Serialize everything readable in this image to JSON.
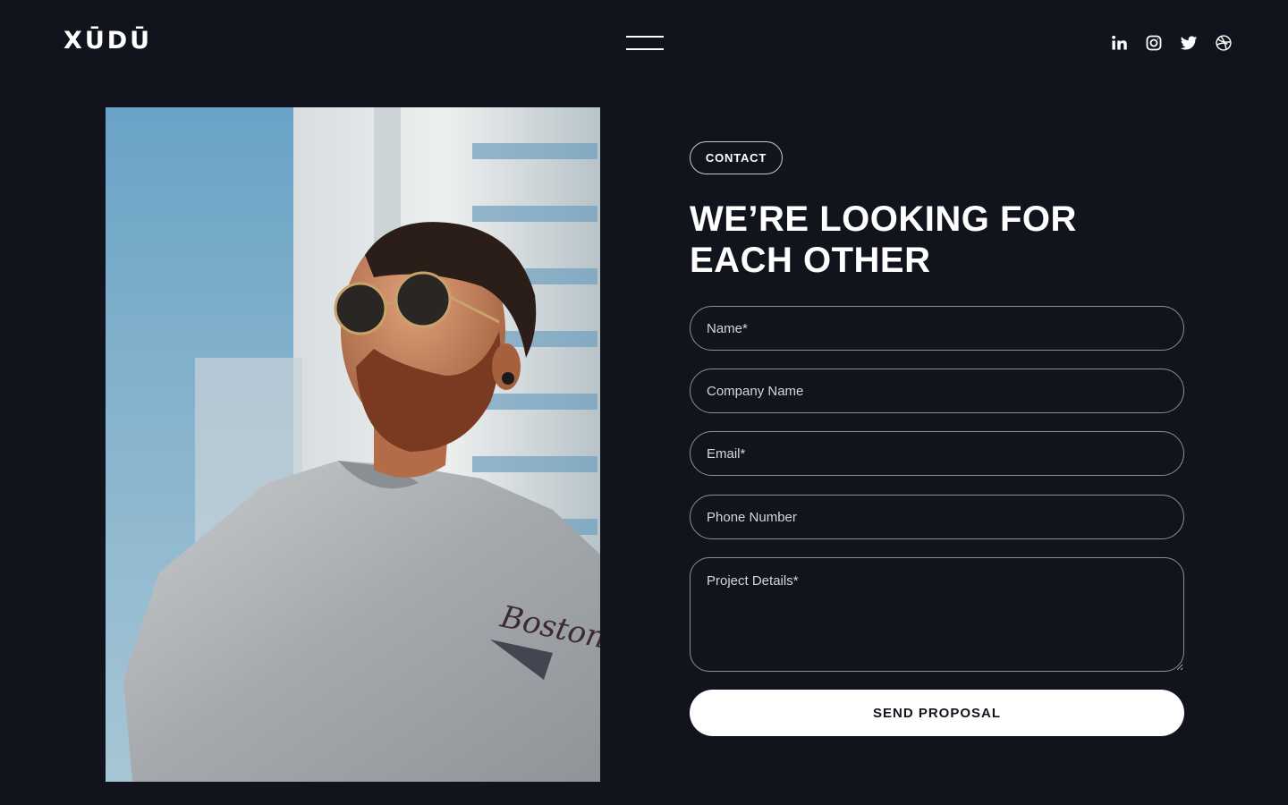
{
  "header": {
    "logo": "XŪDŪ",
    "menu_icon": "hamburger-menu-icon",
    "socials": [
      {
        "name": "linkedin-icon"
      },
      {
        "name": "instagram-icon"
      },
      {
        "name": "twitter-icon"
      },
      {
        "name": "dribbble-icon"
      }
    ]
  },
  "hero_image": {
    "subject": "man-with-sunglasses-photo"
  },
  "contact": {
    "tag": "CONTACT",
    "headline_line1": "WE’RE LOOKING FOR",
    "headline_line2": "EACH OTHER",
    "fields": {
      "name": {
        "placeholder": "Name*",
        "value": ""
      },
      "company": {
        "placeholder": "Company Name",
        "value": ""
      },
      "email": {
        "placeholder": "Email*",
        "value": ""
      },
      "phone": {
        "placeholder": "Phone Number",
        "value": ""
      },
      "details": {
        "placeholder": "Project Details*",
        "value": ""
      }
    },
    "submit_label": "SEND PROPOSAL"
  },
  "colors": {
    "background": "#12141d",
    "text": "#ffffff",
    "field_border": "#8a8d96",
    "button_bg": "#ffffff",
    "button_text": "#12141d"
  }
}
